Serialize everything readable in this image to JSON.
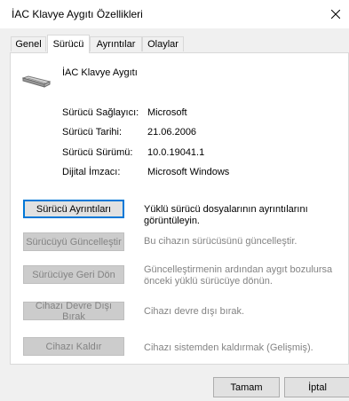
{
  "window": {
    "title": "İAC Klavye Aygıtı Özellikleri"
  },
  "tabs": [
    {
      "label": "Genel"
    },
    {
      "label": "Sürücü"
    },
    {
      "label": "Ayrıntılar"
    },
    {
      "label": "Olaylar"
    }
  ],
  "device": {
    "name": "İAC Klavye Aygıtı",
    "icon": "keyboard-icon"
  },
  "info": [
    {
      "label": "Sürücü Sağlayıcı:",
      "value": "Microsoft"
    },
    {
      "label": "Sürücü Tarihi:",
      "value": "21.06.2006"
    },
    {
      "label": "Sürücü Sürümü:",
      "value": "10.0.19041.1"
    },
    {
      "label": "Dijital İmzacı:",
      "value": "Microsoft Windows"
    }
  ],
  "actions": [
    {
      "button": "Sürücü Ayrıntıları",
      "description": "Yüklü sürücü dosyalarının ayrıntılarını görüntüleyin."
    },
    {
      "button": "Sürücüyü Güncelleştir",
      "description": "Bu cihazın sürücüsünü güncelleştir."
    },
    {
      "button": "Sürücüye Geri Dön",
      "description": "Güncelleştirmenin ardından aygıt bozulursa önceki yüklü sürücüye dönün."
    },
    {
      "button": "Cihazı Devre Dışı Bırak",
      "description": "Cihazı devre dışı bırak."
    },
    {
      "button": "Cihazı Kaldır",
      "description": "Cihazı sistemden kaldırmak (Gelişmiş)."
    }
  ],
  "footer": {
    "ok": "Tamam",
    "cancel": "İptal"
  }
}
